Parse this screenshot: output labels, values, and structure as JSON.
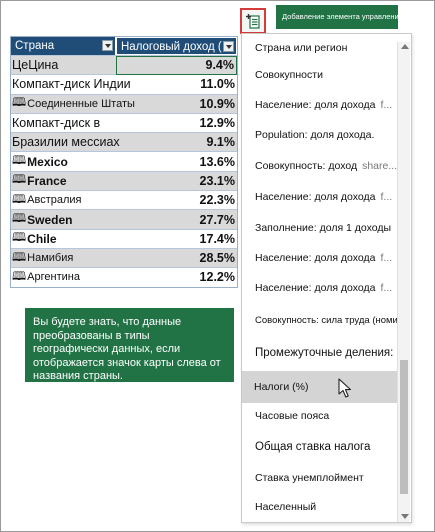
{
  "insert_control": {
    "icon": "insert-data-icon",
    "tooltip": "Добавление элемента управления"
  },
  "table": {
    "headers": [
      "Страна",
      "Налоговый доход ("
    ],
    "rows": [
      {
        "name": "ЦеЦина",
        "value": "9.4%",
        "geo": false
      },
      {
        "name": "Компакт-диск Индии",
        "value": "11.0%",
        "geo": false
      },
      {
        "name": "Соединенные Штаты",
        "value": "10.9%",
        "geo": true
      },
      {
        "name": "Компакт-диск в",
        "value": "12.9%",
        "geo": false
      },
      {
        "name": "Бразилии мессиах",
        "value": "9.1%",
        "geo": false
      },
      {
        "name": "Mexico",
        "value": "13.6%",
        "geo": true
      },
      {
        "name": "France",
        "value": "23.1%",
        "geo": true
      },
      {
        "name": "Австралия",
        "value": "22.3%",
        "geo": true
      },
      {
        "name": "Sweden",
        "value": "27.7%",
        "geo": true
      },
      {
        "name": "Chile",
        "value": "17.4%",
        "geo": true
      },
      {
        "name": "Намибия",
        "value": "28.5%",
        "geo": true
      },
      {
        "name": "Аргентина",
        "value": "12.2%",
        "geo": true
      }
    ]
  },
  "callout": {
    "text": "Вы будете знать, что данные преобразованы в типы географически данных, если отображается значок карты слева от названия страны."
  },
  "field_list": {
    "items": [
      {
        "label": "Страна или регион",
        "extra": ""
      },
      {
        "label": "Совокупности",
        "extra": ""
      },
      {
        "label": "Население: доля дохода",
        "extra": "f..."
      },
      {
        "label": "Population: доля дохода.",
        "extra": ""
      },
      {
        "label": "Совокупность: доход",
        "extra": "share..."
      },
      {
        "label": "Население: доля дохода",
        "extra": "f..."
      },
      {
        "label": "Заполнение: доля 1 доходы",
        "extra": ""
      },
      {
        "label": "Население: доля дохода",
        "extra": "f..."
      },
      {
        "label": "Население: доля дохода",
        "extra": "f..."
      },
      {
        "label": "Совокупность: сила труда (номинал)...",
        "extra": ""
      },
      {
        "label": "Промежуточные деления:",
        "extra": ""
      },
      {
        "label": "Налоги (%)",
        "extra": ""
      },
      {
        "label": "Часовые пояса",
        "extra": ""
      },
      {
        "label": "Общая ставка налога",
        "extra": ""
      },
      {
        "label": "Ставка унемплоймент",
        "extra": ""
      },
      {
        "label": "Населенный",
        "extra": ""
      }
    ],
    "highlighted_index": 11
  },
  "colors": {
    "excel_green": "#217346",
    "header_blue": "#1f4d78",
    "highlight_red": "#d43b3b",
    "row_alt": "#d9d9d9"
  }
}
